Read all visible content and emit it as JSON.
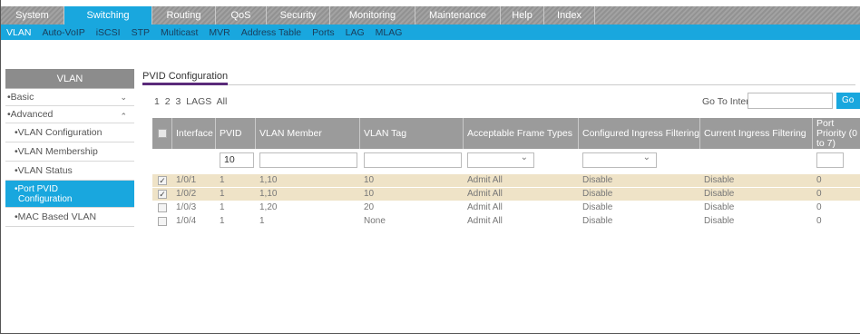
{
  "topnav": {
    "tabs": [
      {
        "label": "System",
        "active": false
      },
      {
        "label": "Switching",
        "active": true
      },
      {
        "label": "Routing",
        "active": false
      },
      {
        "label": "QoS",
        "active": false
      },
      {
        "label": "Security",
        "active": false
      },
      {
        "label": "Monitoring",
        "active": false
      },
      {
        "label": "Maintenance",
        "active": false
      },
      {
        "label": "Help",
        "active": false
      },
      {
        "label": "Index",
        "active": false
      }
    ]
  },
  "subnav": {
    "items": [
      {
        "label": "VLAN",
        "active": true
      },
      {
        "label": "Auto-VoIP",
        "active": false
      },
      {
        "label": "iSCSI",
        "active": false
      },
      {
        "label": "STP",
        "active": false
      },
      {
        "label": "Multicast",
        "active": false
      },
      {
        "label": "MVR",
        "active": false
      },
      {
        "label": "Address Table",
        "active": false
      },
      {
        "label": "Ports",
        "active": false
      },
      {
        "label": "LAG",
        "active": false
      },
      {
        "label": "MLAG",
        "active": false
      }
    ]
  },
  "sidebar": {
    "header": "VLAN",
    "basic": "•Basic",
    "advanced": "•Advanced",
    "items": [
      {
        "label": "•VLAN Configuration",
        "active": false
      },
      {
        "label": "•VLAN Membership",
        "active": false
      },
      {
        "label": "•VLAN Status",
        "active": false
      },
      {
        "label": "•Port PVID",
        "label2": "Configuration",
        "active": true
      },
      {
        "label": "•MAC Based VLAN",
        "active": false
      }
    ]
  },
  "content": {
    "tab_label": "PVID Configuration",
    "pager": [
      "1",
      "2",
      "3",
      "LAGS",
      "All"
    ],
    "goto_label": "Go To Interface",
    "goto_input": "",
    "goto_button": "Go"
  },
  "table": {
    "columns": [
      "Interface",
      "PVID",
      "VLAN Member",
      "VLAN Tag",
      "Acceptable Frame Types",
      "Configured Ingress Filtering",
      "Current Ingress Filtering",
      "Port Priority (0 to 7)"
    ],
    "filter": {
      "pvid": "10",
      "vlan_member": "",
      "vlan_tag": "",
      "frame_types": "",
      "ingress": "",
      "priority": ""
    },
    "rows": [
      {
        "checked": true,
        "interface": "1/0/1",
        "pvid": "1",
        "vlan_member": "1,10",
        "vlan_tag": "10",
        "frame_types": "Admit All",
        "cfg_ingress": "Disable",
        "cur_ingress": "Disable",
        "priority": "0"
      },
      {
        "checked": true,
        "interface": "1/0/2",
        "pvid": "1",
        "vlan_member": "1,10",
        "vlan_tag": "10",
        "frame_types": "Admit All",
        "cfg_ingress": "Disable",
        "cur_ingress": "Disable",
        "priority": "0"
      },
      {
        "checked": false,
        "interface": "1/0/3",
        "pvid": "1",
        "vlan_member": "1,20",
        "vlan_tag": "20",
        "frame_types": "Admit All",
        "cfg_ingress": "Disable",
        "cur_ingress": "Disable",
        "priority": "0"
      },
      {
        "checked": false,
        "interface": "1/0/4",
        "pvid": "1",
        "vlan_member": "1",
        "vlan_tag": "None",
        "frame_types": "Admit All",
        "cfg_ingress": "Disable",
        "cur_ingress": "Disable",
        "priority": "0"
      }
    ]
  }
}
